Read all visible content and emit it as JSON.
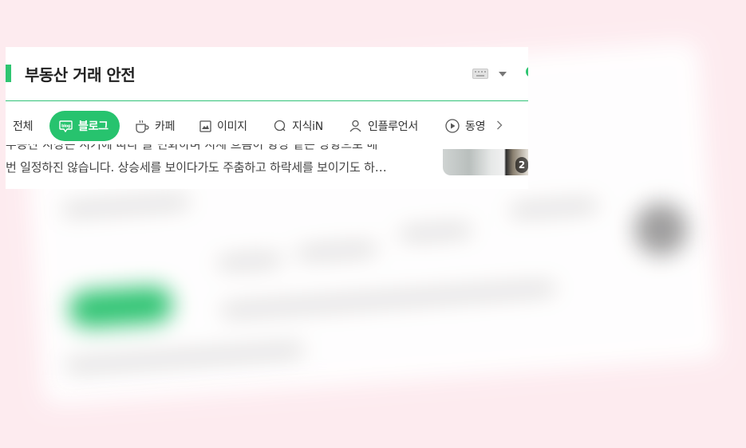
{
  "header": {
    "title": "부동산 거래 안전"
  },
  "tabs": [
    {
      "label": "전체",
      "icon": "all-icon"
    },
    {
      "label": "블로그",
      "icon": "blog-icon",
      "active": true
    },
    {
      "label": "카페",
      "icon": "cafe-icon"
    },
    {
      "label": "이미지",
      "icon": "image-icon"
    },
    {
      "label": "지식iN",
      "icon": "kin-icon"
    },
    {
      "label": "인플루언서",
      "icon": "influencer-icon"
    },
    {
      "label": "동영",
      "icon": "video-icon"
    }
  ],
  "result": {
    "snippet": "번 일정하진 않습니다. 상승세를 보이다가도 주춤하고 하락세를 보이기도 하…",
    "snippet_above": "부동산 시장은 시기에 따라 늘 변화하며 시세 흐름이 항상 같은 방향으로 매",
    "image_count": "2"
  },
  "colors": {
    "accent": "#27c36e",
    "background": "#fdebef"
  }
}
